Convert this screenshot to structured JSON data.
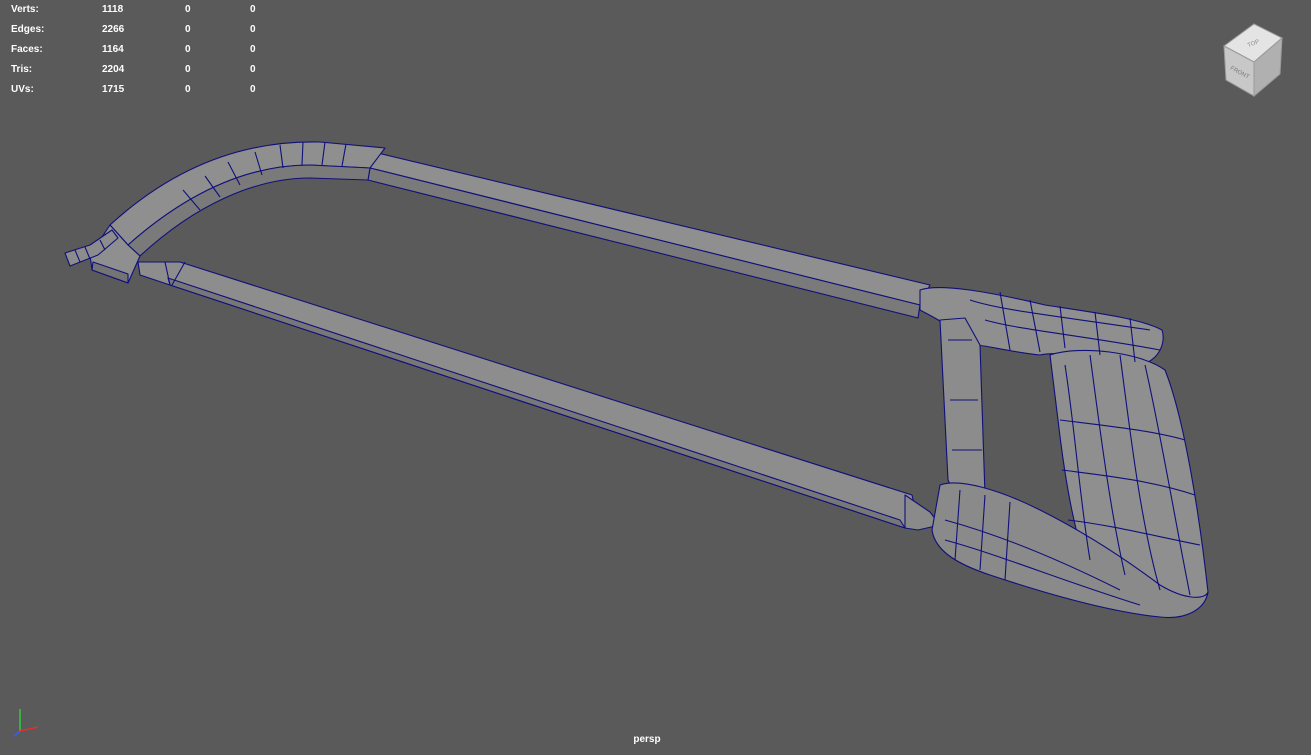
{
  "hud": {
    "rows": [
      {
        "label": "Verts:",
        "v1": "1118",
        "v2": "0",
        "v3": "0"
      },
      {
        "label": "Edges:",
        "v1": "2266",
        "v2": "0",
        "v3": "0"
      },
      {
        "label": "Faces:",
        "v1": "1164",
        "v2": "0",
        "v3": "0"
      },
      {
        "label": "Tris:",
        "v1": "2204",
        "v2": "0",
        "v3": "0"
      },
      {
        "label": "UVs:",
        "v1": "1715",
        "v2": "0",
        "v3": "0"
      }
    ]
  },
  "viewcube": {
    "top_label": "TOP",
    "front_label": "FRONT"
  },
  "camera": {
    "label": "persp"
  },
  "colors": {
    "background": "#5a5a5a",
    "mesh_fill": "#8c8c8c",
    "wireframe": "#0f0f80",
    "hud_text": "#ffffff"
  },
  "icons": {
    "axis_gizmo": "xyz-axis-icon",
    "viewcube": "viewcube-icon"
  }
}
